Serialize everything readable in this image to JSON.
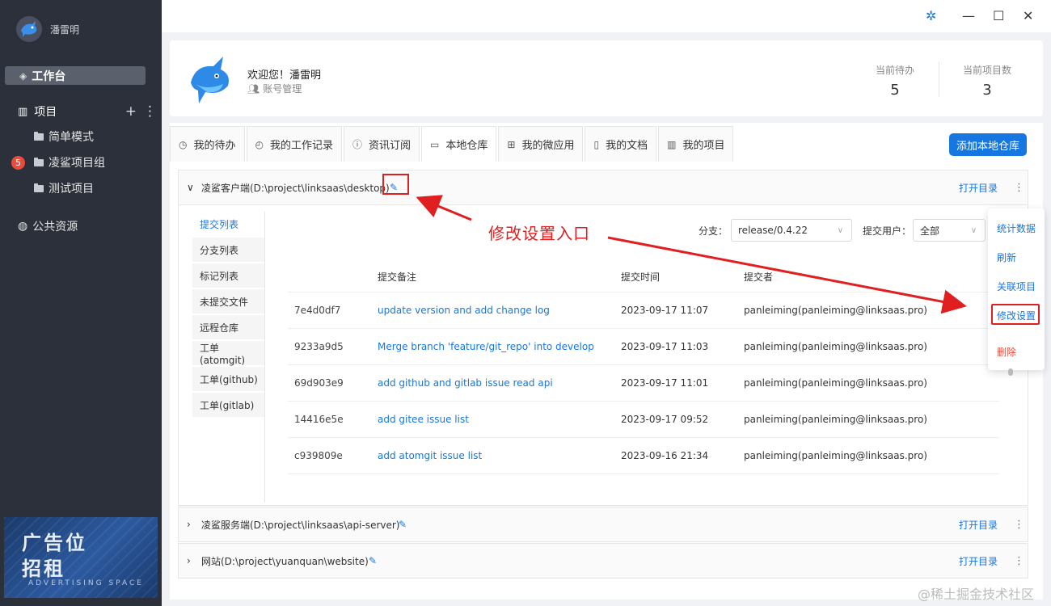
{
  "sidebar": {
    "user_name": "潘雷明",
    "workbench": "工作台",
    "projects_label": "项目",
    "project_items": [
      {
        "label": "简单模式"
      },
      {
        "label": "凌鲨项目组",
        "badge": "5"
      },
      {
        "label": "测试项目"
      }
    ],
    "public_resources": "公共资源",
    "ad": {
      "line1": "广告位",
      "line2": "招租",
      "line3": "ADVERTISING SPACE"
    }
  },
  "profile": {
    "welcome": "欢迎您！潘雷明",
    "account_manage": "账号管理",
    "todo_label": "当前待办",
    "todo_value": "5",
    "project_count_label": "当前项目数",
    "project_count_value": "3"
  },
  "tabs": [
    {
      "label": "我的待办",
      "icon": "clock-check-icon"
    },
    {
      "label": "我的工作记录",
      "icon": "history-icon"
    },
    {
      "label": "资讯订阅",
      "icon": "info-icon"
    },
    {
      "label": "本地仓库",
      "icon": "folder-icon"
    },
    {
      "label": "我的微应用",
      "icon": "apps-icon"
    },
    {
      "label": "我的文档",
      "icon": "doc-icon"
    },
    {
      "label": "我的项目",
      "icon": "project-icon"
    }
  ],
  "add_repo_button": "添加本地仓库",
  "repos": [
    {
      "title": "凌鲨客户端(D:\\project\\linksaas\\desktop)",
      "open": "打开目录"
    },
    {
      "title": "凌鲨服务端(D:\\project\\linksaas\\api-server)",
      "open": "打开目录"
    },
    {
      "title": "网站(D:\\project\\yuanquan\\website)",
      "open": "打开目录"
    }
  ],
  "side_tabs": [
    "提交列表",
    "分支列表",
    "标记列表",
    "未提交文件",
    "远程仓库",
    "工单(atomgit)",
    "工单(github)",
    "工单(gitlab)"
  ],
  "filters": {
    "branch_label": "分支：",
    "branch_value": "release/0.4.22",
    "user_label": "提交用户：",
    "user_value": "全部"
  },
  "commit_table": {
    "headers": [
      "提交备注",
      "提交时间",
      "提交者"
    ],
    "rows": [
      {
        "hash": "7e4d0df7",
        "msg": "update version and add change log",
        "time": "2023-09-17 11:07",
        "author": "panleiming(panleiming@linksaas.pro)"
      },
      {
        "hash": "9233a9d5",
        "msg": "Merge branch 'feature/git_repo' into develop",
        "time": "2023-09-17 11:03",
        "author": "panleiming(panleiming@linksaas.pro)"
      },
      {
        "hash": "69d903e9",
        "msg": "add github and gitlab issue read api",
        "time": "2023-09-17 11:01",
        "author": "panleiming(panleiming@linksaas.pro)"
      },
      {
        "hash": "14416e5e",
        "msg": "add gitee issue list",
        "time": "2023-09-17 09:52",
        "author": "panleiming(panleiming@linksaas.pro)"
      },
      {
        "hash": "c939809e",
        "msg": "add atomgit issue list",
        "time": "2023-09-16 21:34",
        "author": "panleiming(panleiming@linksaas.pro)"
      }
    ]
  },
  "context_menu": [
    "统计数据",
    "刷新",
    "关联项目",
    "修改设置",
    "删除"
  ],
  "annotation_text": "修改设置入口",
  "watermark": "@稀土掘金技术社区",
  "colors": {
    "accent": "#1677e0",
    "sidebar": "#2b303a",
    "danger": "#e02020"
  }
}
